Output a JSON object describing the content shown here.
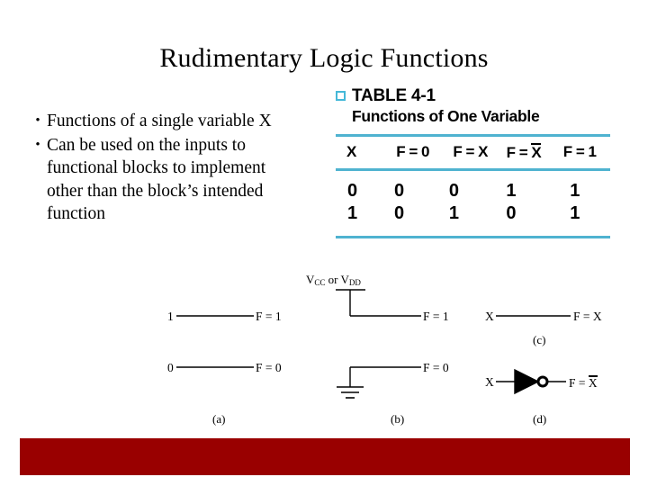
{
  "slide": {
    "title": "Rudimentary Logic Functions",
    "accent_blue": "#4fb3d0",
    "bar_color": "#990000"
  },
  "bullets": [
    {
      "marker": "•",
      "text": "Functions of a single variable X"
    },
    {
      "marker": "•",
      "text": "Can be used on the inputs to functional blocks to implement other than the block’s intended function"
    }
  ],
  "table": {
    "bullet_marker": "square-outline",
    "caption": "TABLE 4-1",
    "subcaption": "Functions of  One  Variable",
    "headers": [
      "X",
      "F = 0",
      "F = X",
      "F = ",
      "F = 1"
    ],
    "header_overbar_col": "X",
    "rows": [
      [
        "0",
        "0",
        "0",
        "1",
        "1"
      ],
      [
        "1",
        "0",
        "1",
        "0",
        "1"
      ]
    ]
  },
  "figures": {
    "a": {
      "label": "(a)",
      "top_input": "1",
      "top_output": "F =  1",
      "bottom_input": "0",
      "bottom_output": "F =  0"
    },
    "b": {
      "label": "(b)",
      "supply_prefix": "V",
      "supply_sub1": "CC",
      "supply_mid": " or V",
      "supply_sub2": "DD",
      "top_output": "F =  1",
      "bottom_output": "F =  0"
    },
    "c": {
      "label": "(c)",
      "input": "X",
      "output_prefix": "F =  ",
      "output_var": "X"
    },
    "d": {
      "label": "(d)",
      "input": "X",
      "gate": "inverter",
      "output_prefix": "F = ",
      "output_var": "X",
      "output_overbar": true
    }
  }
}
